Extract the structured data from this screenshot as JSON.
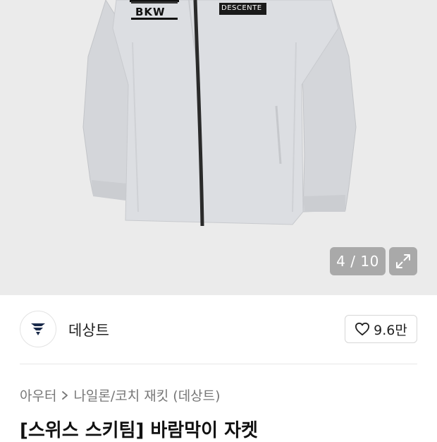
{
  "gallery": {
    "current": "4",
    "separator": " / ",
    "total": "10",
    "jacket_brand_text": "DESCENTE",
    "jacket_chest_text": "BKW"
  },
  "brand": {
    "name": "데상트",
    "likes": "9.6만"
  },
  "breadcrumb": {
    "category": "아우터",
    "subcategory": "나일론/코치 재킷 (데상트)"
  },
  "product": {
    "title": "[스위스 스키팀] 바람막이 자켓"
  },
  "colors": {
    "image_bg": "#ebebeb",
    "jacket": "#d9dbdf",
    "zipper": "#2a2a2a",
    "overlay": "#969696"
  },
  "icons": {
    "expand": "expand-icon",
    "heart": "heart-icon",
    "chevron": "chevron-right-icon",
    "logo": "descente-logo-icon"
  }
}
